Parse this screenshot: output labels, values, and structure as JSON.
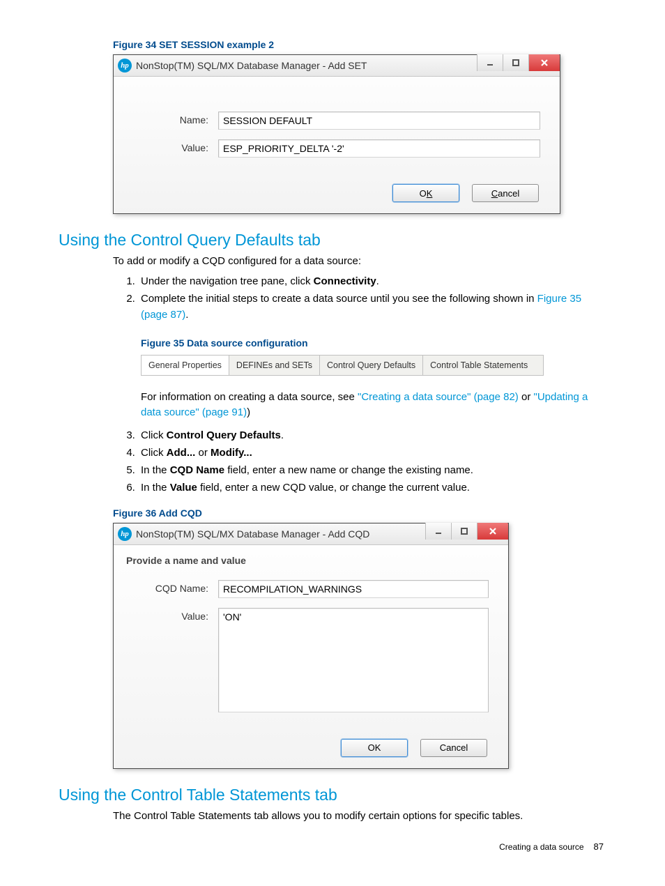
{
  "figure34": {
    "caption": "Figure 34 SET SESSION example 2",
    "title": "NonStop(TM) SQL/MX Database Manager - Add SET",
    "name_label": "Name:",
    "name_value": "SESSION DEFAULT",
    "value_label": "Value:",
    "value_value": "ESP_PRIORITY_DELTA '-2'",
    "ok": "OK",
    "cancel": "Cancel"
  },
  "section1": {
    "heading": "Using the Control Query Defaults tab",
    "intro": "To add or modify a CQD configured for a data source:",
    "step1a": "Under the navigation tree pane, click ",
    "step1b": "Connectivity",
    "step1c": ".",
    "step2a": "Complete the initial steps to create a data source until you see the following shown in ",
    "step2link": "Figure 35 (page 87)",
    "step2b": ".",
    "fig35_caption": "Figure 35 Data source configuration",
    "tabs": [
      "General Properties",
      "DEFINEs and SETs",
      "Control Query Defaults",
      "Control Table Statements"
    ],
    "after_tabs_a": "For information on creating a data source, see ",
    "after_tabs_link1": "\"Creating a data source\" (page 82)",
    "after_tabs_or": " or ",
    "after_tabs_link2": "\"Updating a data source\" (page 91)",
    "after_tabs_b": ")",
    "step3a": "Click ",
    "step3b": "Control Query Defaults",
    "step3c": ".",
    "step4a": "Click ",
    "step4b": "Add...",
    "step4or": " or ",
    "step4c": "Modify...",
    "step5a": "In the ",
    "step5b": "CQD Name",
    "step5c": " field, enter a new name or change the existing name.",
    "step6a": "In the ",
    "step6b": "Value",
    "step6c": " field, enter a new CQD value, or change the current value."
  },
  "figure36": {
    "caption": "Figure 36 Add CQD",
    "title": "NonStop(TM) SQL/MX Database Manager - Add CQD",
    "instruction": "Provide a name and value",
    "name_label": "CQD Name:",
    "name_value": "RECOMPILATION_WARNINGS",
    "value_label": "Value:",
    "value_value": "'ON'",
    "ok": "OK",
    "cancel": "Cancel"
  },
  "section2": {
    "heading": "Using the Control Table Statements tab",
    "body": "The Control Table Statements tab allows you to modify certain options for specific tables."
  },
  "footer": {
    "text": "Creating a data source",
    "page": "87"
  }
}
